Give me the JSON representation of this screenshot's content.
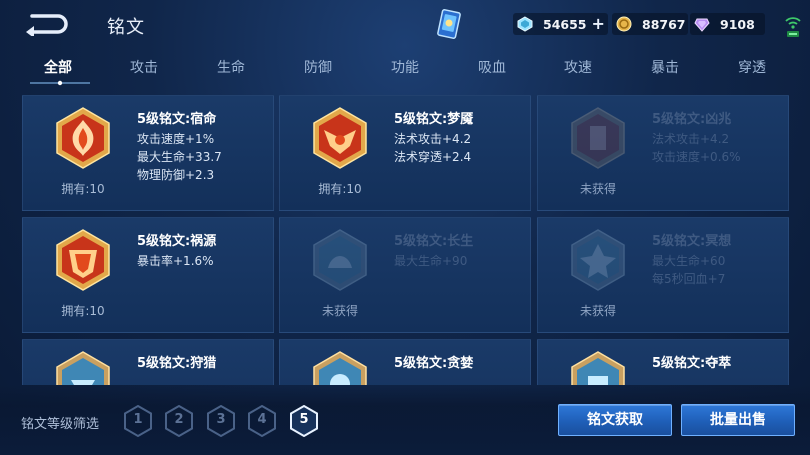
{
  "header": {
    "title": "铭文",
    "currencies": [
      {
        "icon": "diamond-icon",
        "value": "54655",
        "color": "#7fd3f2"
      },
      {
        "icon": "gold-coin-icon",
        "value": "88767",
        "color": "#e7b54a"
      },
      {
        "icon": "gem-icon",
        "value": "9108",
        "color": "#b78cf0"
      }
    ]
  },
  "tabs": [
    {
      "label": "全部",
      "active": true
    },
    {
      "label": "攻击"
    },
    {
      "label": "生命"
    },
    {
      "label": "防御"
    },
    {
      "label": "功能"
    },
    {
      "label": "吸血"
    },
    {
      "label": "攻速"
    },
    {
      "label": "暴击"
    },
    {
      "label": "穿透"
    }
  ],
  "cards": [
    {
      "name": "5级铭文:宿命",
      "stats": [
        "攻击速度+1%",
        "最大生命+33.7",
        "物理防御+2.3"
      ],
      "owned": "拥有:10",
      "obtained": true,
      "color": "#c8341a"
    },
    {
      "name": "5级铭文:梦魇",
      "stats": [
        "法术攻击+4.2",
        "法术穿透+2.4"
      ],
      "owned": "拥有:10",
      "obtained": true,
      "color": "#c8341a"
    },
    {
      "name": "5级铭文:凶兆",
      "stats": [
        "法术攻击+4.2",
        "攻击速度+0.6%"
      ],
      "owned": "未获得",
      "obtained": false,
      "color": "#8a3a3a"
    },
    {
      "name": "5级铭文:祸源",
      "stats": [
        "暴击率+1.6%"
      ],
      "owned": "拥有:10",
      "obtained": true,
      "color": "#c8341a"
    },
    {
      "name": "5级铭文:长生",
      "stats": [
        "最大生命+90"
      ],
      "owned": "未获得",
      "obtained": false,
      "color": "#4a8ab0"
    },
    {
      "name": "5级铭文:冥想",
      "stats": [
        "最大生命+60",
        "每5秒回血+7"
      ],
      "owned": "未获得",
      "obtained": false,
      "color": "#4a8ab0"
    },
    {
      "name": "5级铭文:狩猎",
      "stats": [],
      "owned": "",
      "obtained": true,
      "color": "#3f87b5"
    },
    {
      "name": "5级铭文:贪婪",
      "stats": [],
      "owned": "",
      "obtained": true,
      "color": "#3f87b5"
    },
    {
      "name": "5级铭文:夺萃",
      "stats": [],
      "owned": "",
      "obtained": true,
      "color": "#3f87b5"
    }
  ],
  "footer": {
    "filter_label": "铭文等级筛选",
    "levels": [
      "1",
      "2",
      "3",
      "4",
      "5"
    ],
    "active_level": "5",
    "acquire_label": "铭文获取",
    "sell_label": "批量出售"
  }
}
